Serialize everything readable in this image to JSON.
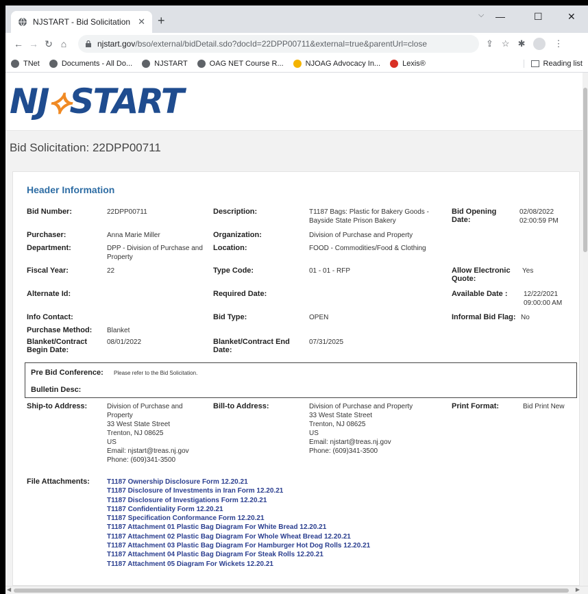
{
  "browser": {
    "tab_title": "NJSTART - Bid Solicitation",
    "tab_close": "✕",
    "new_tab": "+",
    "url_host": "njstart.gov",
    "url_path": "/bso/external/bidDetail.sdo?docId=22DPP00711&external=true&parentUrl=close",
    "bookmarks": [
      "TNet",
      "Documents - All Do...",
      "NJSTART",
      "OAG NET Course R...",
      "NJOAG Advocacy In...",
      "Lexis®"
    ],
    "reading_list": "Reading list"
  },
  "page": {
    "logo_nj": "NJ",
    "logo_rest": "START",
    "title": "Bid Solicitation: 22DPP00711",
    "section_title": "Header Information"
  },
  "fields": {
    "bid_number_label": "Bid Number:",
    "bid_number": "22DPP00711",
    "description_label": "Description:",
    "description": "T1187 Bags: Plastic for Bakery Goods - Bayside State Prison Bakery",
    "bid_opening_label": "Bid Opening Date:",
    "bid_opening": "02/08/2022 02:00:59 PM",
    "purchaser_label": "Purchaser:",
    "purchaser": "Anna Marie Miller",
    "organization_label": "Organization:",
    "organization": "Division of Purchase and Property",
    "department_label": "Department:",
    "department": "DPP - Division of Purchase and Property",
    "location_label": "Location:",
    "location": "FOOD - Commodities/Food & Clothing",
    "fiscal_year_label": "Fiscal Year:",
    "fiscal_year": "22",
    "type_code_label": "Type Code:",
    "type_code": "01 - 01 - RFP",
    "allow_quote_label": "Allow Electronic Quote:",
    "allow_quote": "Yes",
    "alternate_id_label": "Alternate Id:",
    "required_date_label": "Required Date:",
    "available_date_label": "Available Date :",
    "available_date": "12/22/2021 09:00:00 AM",
    "info_contact_label": "Info Contact:",
    "bid_type_label": "Bid Type:",
    "bid_type": "OPEN",
    "informal_flag_label": "Informal Bid Flag:",
    "informal_flag": "No",
    "purchase_method_label": "Purchase Method:",
    "purchase_method": "Blanket",
    "begin_date_label": "Blanket/Contract Begin Date:",
    "begin_date": "08/01/2022",
    "end_date_label": "Blanket/Contract End Date:",
    "end_date": "07/31/2025",
    "pre_bid_label": "Pre Bid Conference:",
    "pre_bid": "Please refer to the Bid Solicitation.",
    "bulletin_label": "Bulletin Desc:",
    "ship_to_label": "Ship-to Address:",
    "ship_to": [
      "Division of Purchase and",
      "Property",
      "33 West State Street",
      "Trenton, NJ 08625",
      "US",
      "Email: njstart@treas.nj.gov",
      "Phone: (609)341-3500"
    ],
    "bill_to_label": "Bill-to Address:",
    "bill_to": [
      "Division of Purchase and Property",
      "33 West State Street",
      "Trenton, NJ 08625",
      "US",
      "Email: njstart@treas.nj.gov",
      "Phone: (609)341-3500"
    ],
    "print_format_label": "Print Format:",
    "print_format": "Bid Print New",
    "attachments_label": "File Attachments:"
  },
  "attachments": [
    "T1187 Ownership Disclosure Form 12.20.21",
    "T1187 Disclosure of Investments in Iran Form 12.20.21",
    "T1187 Disclosure of Investigations Form 12.20.21",
    "T1187 Confidentiality Form 12.20.21",
    "T1187 Specification Conformance Form 12.20.21",
    "T1187 Attachment 01 Plastic Bag Diagram For White Bread 12.20.21",
    "T1187 Attachment 02 Plastic Bag Diagram For Whole Wheat Bread 12.20.21",
    "T1187 Attachment 03 Plastic Bag Diagram For Hamburger Hot Dog Rolls 12.20.21",
    "T1187 Attachment 04 Plastic Bag Diagram For Steak Rolls 12.20.21",
    "T1187 Attachment 05 Diagram For Wickets 12.20.21"
  ]
}
